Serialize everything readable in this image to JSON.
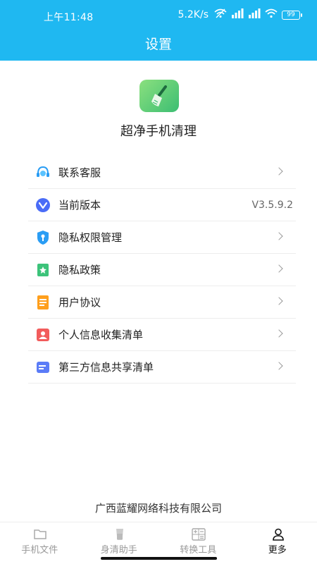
{
  "status": {
    "time": "上午11:48",
    "speed": "5.2K/s",
    "battery": "99"
  },
  "header": {
    "title": "设置"
  },
  "app": {
    "name": "超净手机清理"
  },
  "menu": [
    {
      "label": "联系客服",
      "icon": "headset-icon"
    },
    {
      "label": "当前版本",
      "icon": "version-icon",
      "value": "V3.5.9.2"
    },
    {
      "label": "隐私权限管理",
      "icon": "shield-lock-icon"
    },
    {
      "label": "隐私政策",
      "icon": "bookmark-star-icon"
    },
    {
      "label": "用户协议",
      "icon": "document-icon"
    },
    {
      "label": "个人信息收集清单",
      "icon": "person-card-icon"
    },
    {
      "label": "第三方信息共享清单",
      "icon": "list-card-icon"
    }
  ],
  "footer": {
    "company": "广西蓝耀网络科技有限公司"
  },
  "bottom_nav": [
    {
      "label": "手机文件",
      "icon": "folder-icon",
      "active": false
    },
    {
      "label": "身清助手",
      "icon": "cup-icon",
      "active": false
    },
    {
      "label": "转换工具",
      "icon": "calculator-icon",
      "active": false
    },
    {
      "label": "更多",
      "icon": "person-icon",
      "active": true
    }
  ],
  "colors": {
    "header": "#1FB8F1",
    "active": "#111111",
    "inactive": "#999999"
  }
}
